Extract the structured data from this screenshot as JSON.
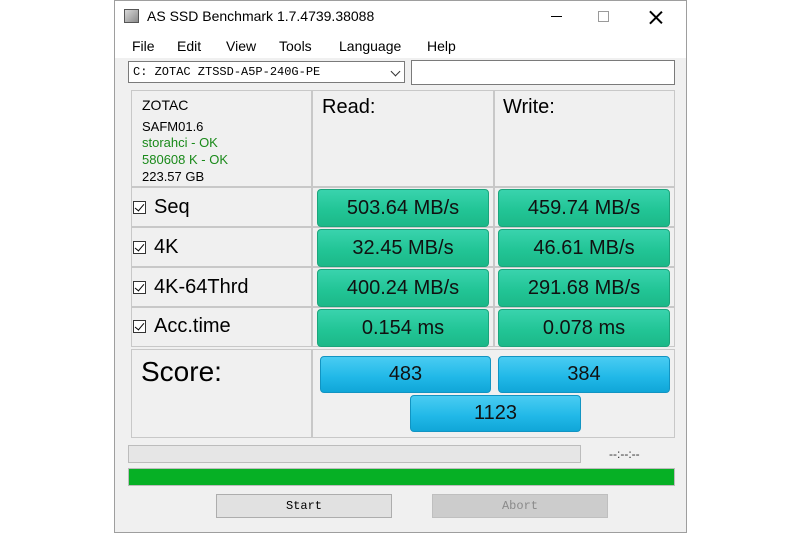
{
  "window": {
    "title": "AS SSD Benchmark 1.7.4739.38088"
  },
  "menu": [
    "File",
    "Edit",
    "View",
    "Tools",
    "Language",
    "Help"
  ],
  "drive": {
    "selected": "C: ZOTAC ZTSSD-A5P-240G-PE",
    "text_field_value": ""
  },
  "info": {
    "vendor": "ZOTAC",
    "firmware": "SAFM01.6",
    "driver_status": "storahci - OK",
    "alignment_status": "580608 K - OK",
    "capacity": "223.57 GB"
  },
  "columns": {
    "read": "Read:",
    "write": "Write:"
  },
  "tests": [
    {
      "label": "Seq",
      "checked": true,
      "read": "503.64 MB/s",
      "write": "459.74 MB/s"
    },
    {
      "label": "4K",
      "checked": true,
      "read": "32.45 MB/s",
      "write": "46.61 MB/s"
    },
    {
      "label": "4K-64Thrd",
      "checked": true,
      "read": "400.24 MB/s",
      "write": "291.68 MB/s"
    },
    {
      "label": "Acc.time",
      "checked": true,
      "read": "0.154 ms",
      "write": "0.078 ms"
    }
  ],
  "score": {
    "label": "Score:",
    "read": "483",
    "write": "384",
    "total": "1123"
  },
  "progress": {
    "elapsed_text": "--:--:--",
    "test_progress": 0,
    "overall_progress": 1.0
  },
  "buttons": {
    "start": "Start",
    "abort": "Abort",
    "abort_enabled": false
  },
  "colors": {
    "ok_text": "#1a8a1a",
    "result_green": "#22c596",
    "score_blue": "#22b9e8",
    "progress_green": "#06b025"
  },
  "icons": {
    "app": "app-icon",
    "dropdown": "chevron-down-icon"
  }
}
